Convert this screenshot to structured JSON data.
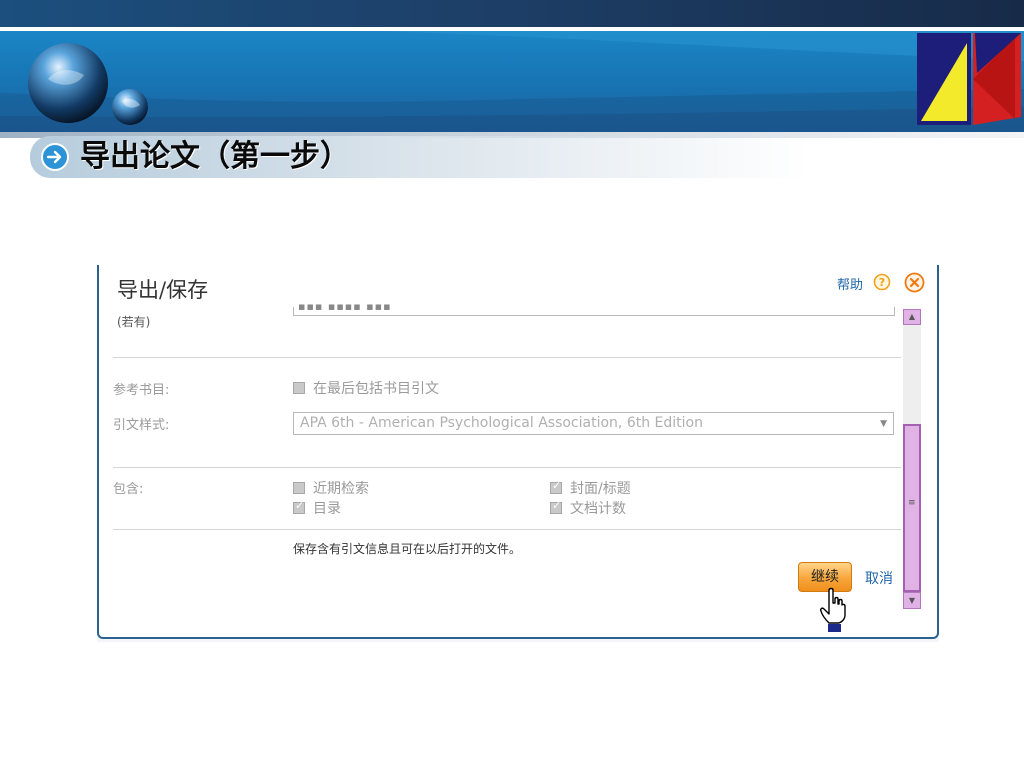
{
  "slide": {
    "title": "导出论文（第一步）"
  },
  "dialog": {
    "title": "导出/保存",
    "help_label": "帮助",
    "fragment_label": "(若有)",
    "bibliography": {
      "label": "参考书目:",
      "checkbox_label": "在最后包括书目引文",
      "checked": false
    },
    "citation_style": {
      "label": "引文样式:",
      "value": "APA 6th - American Psychological Association, 6th Edition"
    },
    "include": {
      "label": "包含:",
      "options": [
        {
          "label": "近期检索",
          "checked": false
        },
        {
          "label": "封面/标题",
          "checked": true
        },
        {
          "label": "目录",
          "checked": true
        },
        {
          "label": "文档计数",
          "checked": true
        }
      ]
    },
    "note": "保存含有引文信息且可在以后打开的文件。",
    "continue_label": "继续",
    "cancel_label": "取消"
  },
  "colors": {
    "banner": "#1873b2",
    "dialog_border": "#2a6190",
    "continue_button": "#f8a63c",
    "scrollbar": "#e1b2e6",
    "link": "#2066a8"
  }
}
